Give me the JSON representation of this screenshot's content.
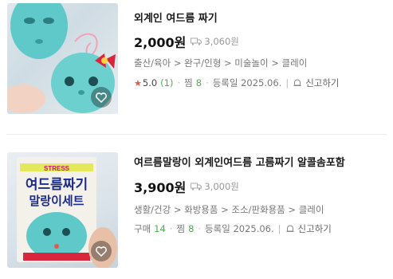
{
  "items": [
    {
      "title": "외계인 여드름 짜기",
      "price": "2,000원",
      "shipping": "3,060원",
      "category": "출산/육아 > 완구/인형 > 미술놀이 > 클레이",
      "rating_value": "5.0",
      "rating_count": "(1)",
      "like_label": "찜",
      "like_count": "8",
      "date": "등록일 2025.06.",
      "report": "신고하기"
    },
    {
      "title": "여르름말랑이 외계인여드름 고름짜기 알콜솜포함",
      "price": "3,900원",
      "shipping": "3,000원",
      "category": "생활/건강 > 화방용품 > 조소/판화용품 > 클레이",
      "purchase_label": "구매",
      "purchase_count": "14",
      "like_label": "찜",
      "like_count": "8",
      "date": "등록일 2025.06.",
      "report": "신고하기"
    }
  ],
  "product_image_text": {
    "line1": "여드름짜기",
    "line2": "말랑이세트",
    "banner": "STRESS"
  },
  "colors": {
    "mask": "#5fc9c9",
    "accent_red": "#e05a4e",
    "green": "#4caf50"
  }
}
